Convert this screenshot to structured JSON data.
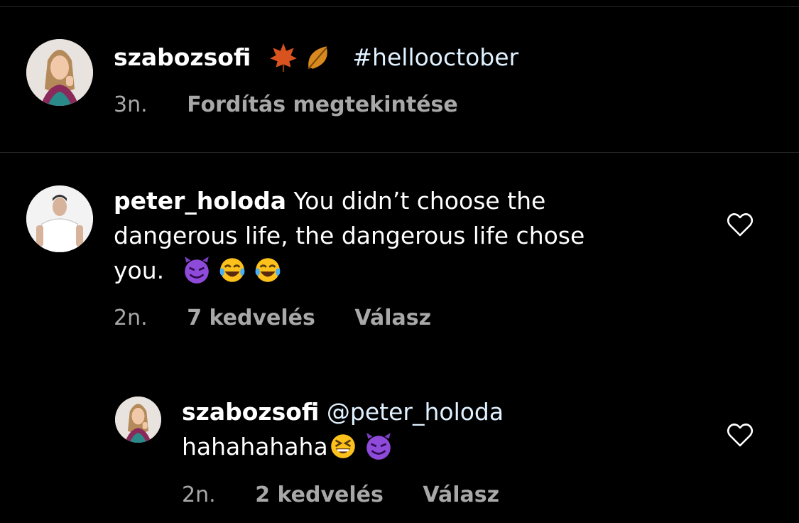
{
  "caption": {
    "username": "szabozsofi",
    "hashtag": "#hellooctober",
    "time": "3n.",
    "translate_label": "Fordítás megtekintése",
    "emojis": [
      "maple-leaf",
      "fallen-leaf"
    ]
  },
  "comments": [
    {
      "username": "peter_holoda",
      "text_line1": "You didn’t choose the",
      "text_line2": "dangerous life, the dangerous life chose",
      "text_line3": "you.",
      "emojis": [
        "smiling-devil",
        "tears-of-joy",
        "tears-of-joy"
      ],
      "time": "2n.",
      "likes": "7 kedvelés",
      "reply_label": "Válasz"
    },
    {
      "username": "szabozsofi",
      "mention": "@peter_holoda",
      "text_line2": "hahahahaha",
      "emojis": [
        "grinning-squinting",
        "smiling-devil"
      ],
      "time": "2n.",
      "likes": "2 kedvelés",
      "reply_label": "Válasz"
    }
  ],
  "colors": {
    "background": "#000000",
    "text": "#ffffff",
    "secondary": "#a8a8a8",
    "mention": "#e0f1ff"
  }
}
